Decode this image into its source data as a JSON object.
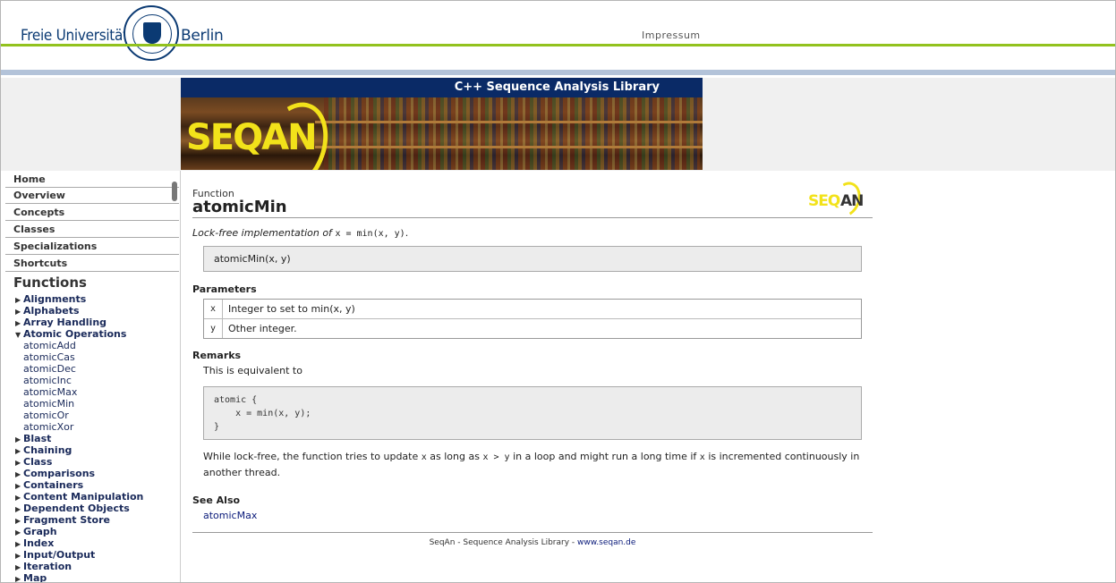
{
  "header": {
    "uni_left": "Freie Universität",
    "uni_right": "Berlin",
    "impressum": "Impressum"
  },
  "banner": {
    "title": "C++ Sequence Analysis Library",
    "logo": "SEQAN"
  },
  "sidebar": {
    "buttons": [
      "Home",
      "Overview",
      "Concepts",
      "Classes",
      "Specializations",
      "Shortcuts"
    ],
    "functions_heading": "Functions",
    "tree": [
      {
        "label": "Alignments",
        "expanded": false
      },
      {
        "label": "Alphabets",
        "expanded": false
      },
      {
        "label": "Array Handling",
        "expanded": false
      },
      {
        "label": "Atomic Operations",
        "expanded": true,
        "children": [
          "atomicAdd",
          "atomicCas",
          "atomicDec",
          "atomicInc",
          "atomicMax",
          "atomicMin",
          "atomicOr",
          "atomicXor"
        ]
      },
      {
        "label": "Blast",
        "expanded": false
      },
      {
        "label": "Chaining",
        "expanded": false
      },
      {
        "label": "Class",
        "expanded": false
      },
      {
        "label": "Comparisons",
        "expanded": false
      },
      {
        "label": "Containers",
        "expanded": false
      },
      {
        "label": "Content Manipulation",
        "expanded": false
      },
      {
        "label": "Dependent Objects",
        "expanded": false
      },
      {
        "label": "Fragment Store",
        "expanded": false
      },
      {
        "label": "Graph",
        "expanded": false
      },
      {
        "label": "Index",
        "expanded": false
      },
      {
        "label": "Input/Output",
        "expanded": false
      },
      {
        "label": "Iteration",
        "expanded": false
      },
      {
        "label": "Map",
        "expanded": false
      }
    ]
  },
  "content": {
    "kind": "Function",
    "name": "atomicMin",
    "small_logo": "SEQAN",
    "description_italic": "Lock-free implementation of",
    "description_code": "x = min(x, y)",
    "description_end": ".",
    "signature": "atomicMin(x, y)",
    "parameters_heading": "Parameters",
    "parameters": [
      {
        "name": "x",
        "desc": "Integer to set to min(x, y)"
      },
      {
        "name": "y",
        "desc": "Other integer."
      }
    ],
    "remarks_heading": "Remarks",
    "remarks_text": "This is equivalent to",
    "code": "atomic {\n    x = min(x, y);\n}",
    "para_1": "While lock-free, the function tries to update",
    "para_code1": "x",
    "para_2": "as long as",
    "para_code2": "x > y",
    "para_3": "in a loop and might run a long time if",
    "para_code3": "x",
    "para_4": "is incremented continuously in another thread.",
    "see_also_heading": "See Also",
    "see_also": "atomicMax",
    "footer_text": "SeqAn - Sequence Analysis Library - ",
    "footer_link": "www.seqan.de"
  }
}
